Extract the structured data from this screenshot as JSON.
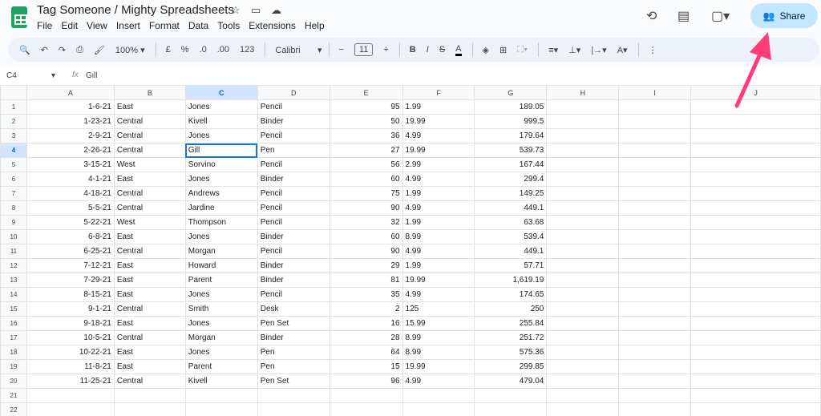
{
  "app": {
    "title": "Tag Someone / Mighty Spreadsheets",
    "menu": [
      "File",
      "Edit",
      "View",
      "Insert",
      "Format",
      "Data",
      "Tools",
      "Extensions",
      "Help"
    ],
    "share_label": "Share"
  },
  "toolbar": {
    "zoom": "100%",
    "currency": "£",
    "percent": "%",
    "dec_decrease": ".0",
    "dec_increase": ".00",
    "number_format": "123",
    "font": "Calibri",
    "font_size": "11"
  },
  "formula_bar": {
    "cell_ref": "C4",
    "fx": "fx",
    "value": "Gill"
  },
  "annotation": {
    "arrow_color": "#ff3b7a"
  },
  "columns": [
    "A",
    "B",
    "C",
    "D",
    "E",
    "F",
    "G",
    "H",
    "I",
    "J"
  ],
  "rows": [
    [
      "1-6-21",
      "East",
      "Jones",
      "Pencil",
      "95",
      "1.99",
      "189.05"
    ],
    [
      "1-23-21",
      "Central",
      "Kivell",
      "Binder",
      "50",
      "19.99",
      "999.5"
    ],
    [
      "2-9-21",
      "Central",
      "Jones",
      "Pencil",
      "36",
      "4.99",
      "179.64"
    ],
    [
      "2-26-21",
      "Central",
      "Gill",
      "Pen",
      "27",
      "19.99",
      "539.73"
    ],
    [
      "3-15-21",
      "West",
      "Sorvino",
      "Pencil",
      "56",
      "2.99",
      "167.44"
    ],
    [
      "4-1-21",
      "East",
      "Jones",
      "Binder",
      "60",
      "4.99",
      "299.4"
    ],
    [
      "4-18-21",
      "Central",
      "Andrews",
      "Pencil",
      "75",
      "1.99",
      "149.25"
    ],
    [
      "5-5-21",
      "Central",
      "Jardine",
      "Pencil",
      "90",
      "4.99",
      "449.1"
    ],
    [
      "5-22-21",
      "West",
      "Thompson",
      "Pencil",
      "32",
      "1.99",
      "63.68"
    ],
    [
      "6-8-21",
      "East",
      "Jones",
      "Binder",
      "60",
      "8.99",
      "539.4"
    ],
    [
      "6-25-21",
      "Central",
      "Morgan",
      "Pencil",
      "90",
      "4.99",
      "449.1"
    ],
    [
      "7-12-21",
      "East",
      "Howard",
      "Binder",
      "29",
      "1.99",
      "57.71"
    ],
    [
      "7-29-21",
      "East",
      "Parent",
      "Binder",
      "81",
      "19.99",
      "1,619.19"
    ],
    [
      "8-15-21",
      "East",
      "Jones",
      "Pencil",
      "35",
      "4.99",
      "174.65"
    ],
    [
      "9-1-21",
      "Central",
      "Smith",
      "Desk",
      "2",
      "125",
      "250"
    ],
    [
      "9-18-21",
      "East",
      "Jones",
      "Pen Set",
      "16",
      "15.99",
      "255.84"
    ],
    [
      "10-5-21",
      "Central",
      "Morgan",
      "Binder",
      "28",
      "8.99",
      "251.72"
    ],
    [
      "10-22-21",
      "East",
      "Jones",
      "Pen",
      "64",
      "8.99",
      "575.36"
    ],
    [
      "11-8-21",
      "East",
      "Parent",
      "Pen",
      "15",
      "19.99",
      "299.85"
    ],
    [
      "11-25-21",
      "Central",
      "Kivell",
      "Pen Set",
      "96",
      "4.99",
      "479.04"
    ],
    [
      "",
      "",
      "",
      "",
      "",
      "",
      ""
    ],
    [
      "",
      "",
      "",
      "",
      "",
      "",
      ""
    ]
  ]
}
